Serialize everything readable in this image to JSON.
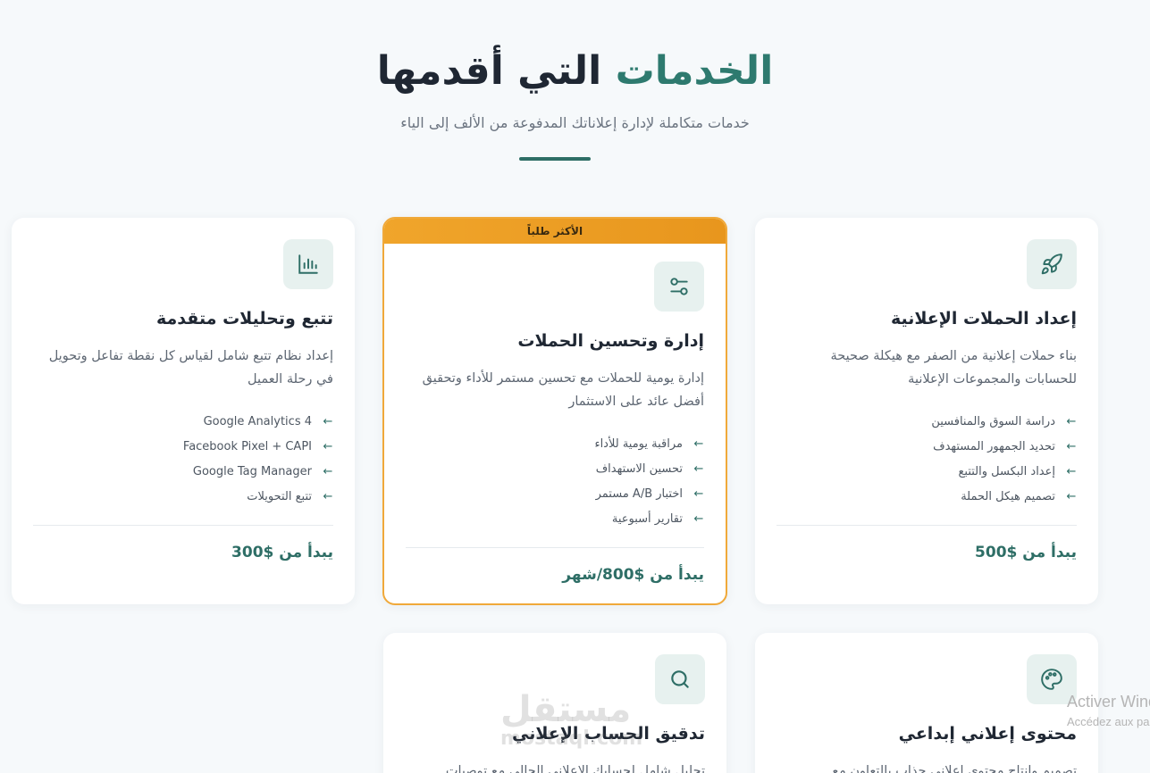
{
  "header": {
    "title_accent": "الخدمات",
    "title_rest": "التي أقدمها",
    "subtitle": "خدمات متكاملة لإدارة إعلاناتك المدفوعة من الألف إلى الياء"
  },
  "cards": [
    {
      "icon": "rocket-icon",
      "title": "إعداد الحملات الإعلانية",
      "description": "بناء حملات إعلانية من الصفر مع هيكلة صحيحة للحسابات والمجموعات الإعلانية",
      "features": [
        "دراسة السوق والمنافسين",
        "تحديد الجمهور المستهدف",
        "إعداد البكسل والتتبع",
        "تصميم هيكل الحملة"
      ],
      "price": "يبدأ من $500"
    },
    {
      "icon": "sliders-icon",
      "badge": "الأكثر طلباً",
      "title": "إدارة وتحسين الحملات",
      "description": "إدارة يومية للحملات مع تحسين مستمر للأداء وتحقيق أفضل عائد على الاستثمار",
      "features": [
        "مراقبة يومية للأداء",
        "تحسين الاستهداف",
        "اختبار A/B مستمر",
        "تقارير أسبوعية"
      ],
      "price": "يبدأ من $800/شهر"
    },
    {
      "icon": "bar-chart-icon",
      "title": "تتبع وتحليلات متقدمة",
      "description": "إعداد نظام تتبع شامل لقياس كل نقطة تفاعل وتحويل في رحلة العميل",
      "features": [
        "Google Analytics 4",
        "Facebook Pixel + CAPI",
        "Google Tag Manager",
        "تتبع التحويلات"
      ],
      "price": "يبدأ من $300"
    },
    {
      "icon": "palette-icon",
      "title": "محتوى إعلاني إبداعي",
      "description": "تصميم وإنتاج محتوى إعلاني جذاب بالتعاون مع"
    },
    {
      "icon": "search-icon",
      "title": "تدقيق الحساب الإعلاني",
      "description": "تحليل شامل لحسابك الإعلاني الحالي مع توصيات"
    }
  ],
  "watermark": {
    "main": "مستقل",
    "sub": "mostaql.com"
  },
  "system_notice": {
    "line1": "Activer Windows",
    "line2": "Accédez aux paramètres pour activer Windows."
  },
  "colors": {
    "accent": "#2e7a6f",
    "featured_border": "#f0a93a",
    "background": "#f6f9fb"
  }
}
